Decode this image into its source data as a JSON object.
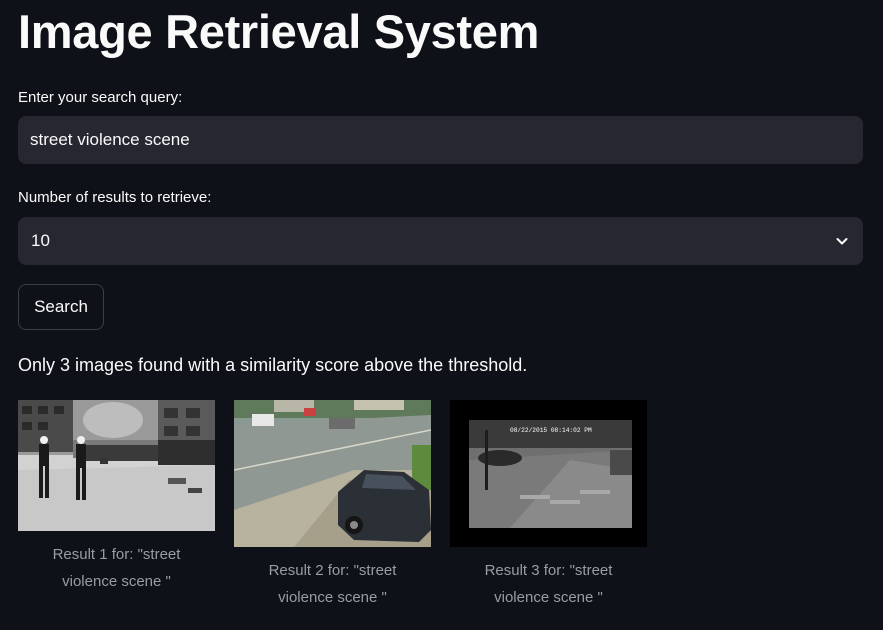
{
  "header": {
    "title": "Image Retrieval System"
  },
  "query": {
    "label": "Enter your search query:",
    "value": "street violence scene"
  },
  "count": {
    "label": "Number of results to retrieve:",
    "selected": "10"
  },
  "search_button": {
    "label": "Search"
  },
  "info_message": "Only 3 images found with a similarity score above the threshold.",
  "results": [
    {
      "caption": "Result 1 for: \"street\nviolence scene \""
    },
    {
      "caption": "Result 2 for: \"street\nviolence scene \""
    },
    {
      "caption": "Result 3 for: \"street\nviolence scene \""
    }
  ],
  "overlay_timestamp": "08/22/2015 08:14:02 PM",
  "colors": {
    "background": "#0e1117",
    "input_bg": "#262730",
    "text": "#fafafa",
    "caption": "#9a9ca4"
  },
  "icons": {
    "select_chevron": "chevron-down-icon"
  }
}
